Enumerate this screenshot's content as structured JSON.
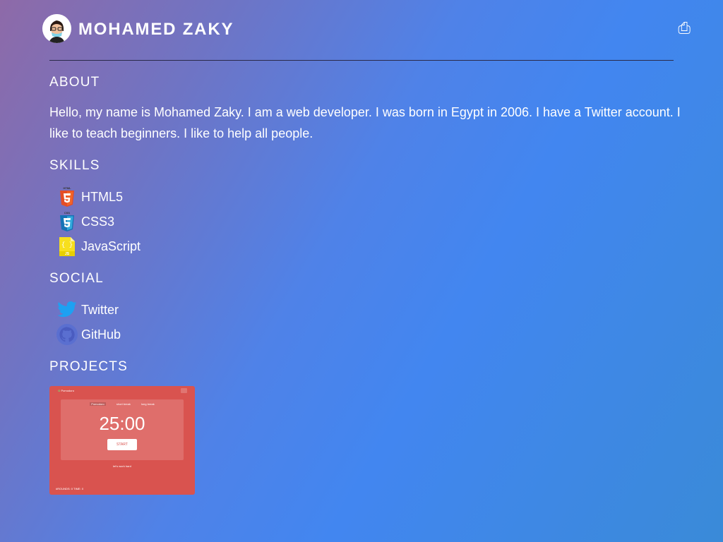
{
  "header": {
    "name": "MOHAMED ZAKY",
    "share_glyph": "⎙"
  },
  "about": {
    "title": "ABOUT",
    "text": "Hello, my name is Mohamed Zaky. I am a web developer. I was born in Egypt in 2006. I have a Twitter account. I like to teach beginners. I like to help all people."
  },
  "skills": {
    "title": "SKILLS",
    "items": [
      {
        "label": "HTML5",
        "icon": "html5-icon",
        "icon_text": "HTML",
        "color": "#e44d26"
      },
      {
        "label": "CSS3",
        "icon": "css3-icon",
        "icon_text": "CSS",
        "color": "#1572b6"
      },
      {
        "label": "JavaScript",
        "icon": "javascript-icon",
        "icon_text": "JS",
        "color": "#f7df1e"
      }
    ]
  },
  "social": {
    "title": "SOCIAL",
    "items": [
      {
        "label": "Twitter",
        "icon": "twitter-icon",
        "color": "#1da1f2"
      },
      {
        "label": "GitHub",
        "icon": "github-icon",
        "color": "#5a6fd0"
      }
    ]
  },
  "projects": {
    "title": "PROJECTS",
    "thumb": {
      "app_name": "Pomodoro",
      "tabs": [
        "Pomodoro",
        "short break",
        "long break"
      ],
      "time": "25:00",
      "start_label": "START",
      "message": "let's work hard",
      "footer": "#ROUNDS: 0   TIME: 0"
    }
  }
}
